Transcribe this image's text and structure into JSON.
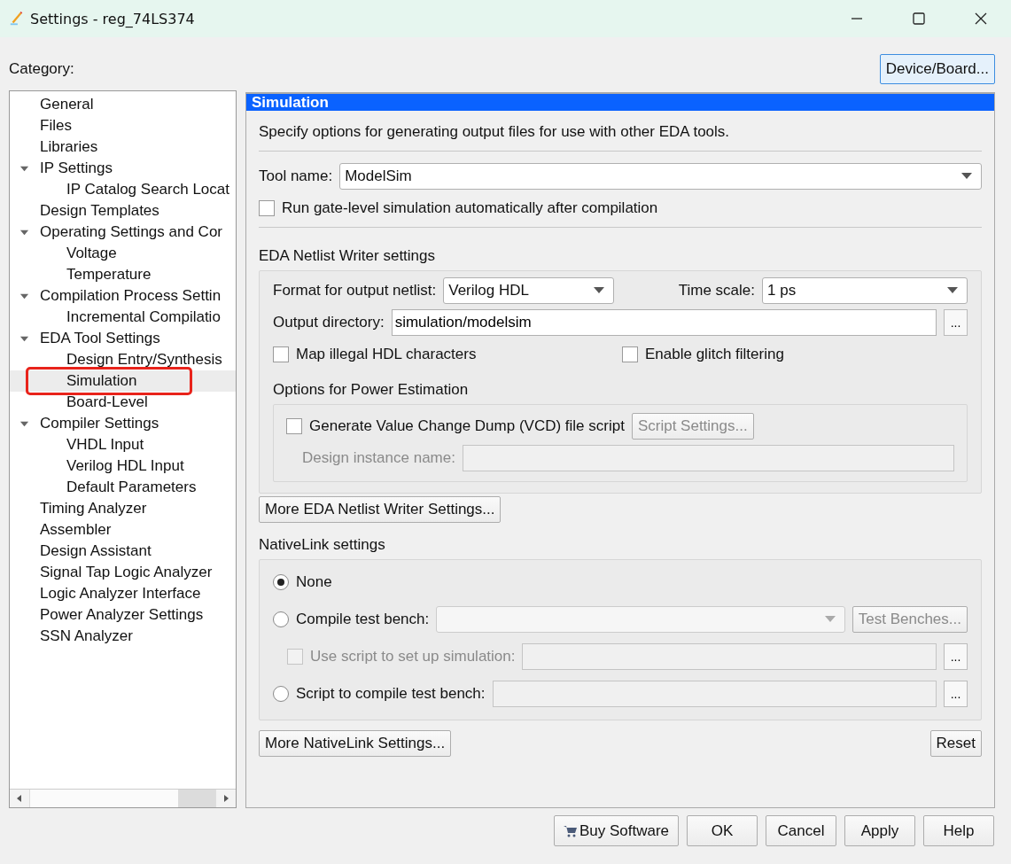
{
  "window": {
    "title": "Settings - reg_74LS374"
  },
  "category_label": "Category:",
  "device_board_button": "Device/Board...",
  "tree": [
    {
      "label": "General",
      "selected": false,
      "marked": false
    },
    {
      "label": "Files",
      "selected": false,
      "marked": false
    },
    {
      "label": "Libraries",
      "selected": false,
      "marked": false
    },
    {
      "label": "IP Settings",
      "selected": false,
      "marked": false,
      "expanded": true,
      "children": [
        {
          "label": "IP Catalog Search Locat",
          "selected": false,
          "marked": false
        }
      ]
    },
    {
      "label": "Design Templates",
      "selected": false,
      "marked": false
    },
    {
      "label": "Operating Settings and Cor",
      "selected": false,
      "marked": false,
      "expanded": true,
      "children": [
        {
          "label": "Voltage",
          "selected": false,
          "marked": false
        },
        {
          "label": "Temperature",
          "selected": false,
          "marked": false
        }
      ]
    },
    {
      "label": "Compilation Process Settin",
      "selected": false,
      "marked": false,
      "expanded": true,
      "children": [
        {
          "label": "Incremental Compilatio",
          "selected": false,
          "marked": false
        }
      ]
    },
    {
      "label": "EDA Tool Settings",
      "selected": false,
      "marked": false,
      "expanded": true,
      "children": [
        {
          "label": "Design Entry/Synthesis",
          "selected": false,
          "marked": false
        },
        {
          "label": "Simulation",
          "selected": true,
          "marked": true
        },
        {
          "label": "Board-Level",
          "selected": false,
          "marked": false
        }
      ]
    },
    {
      "label": "Compiler Settings",
      "selected": false,
      "marked": false,
      "expanded": true,
      "children": [
        {
          "label": "VHDL Input",
          "selected": false,
          "marked": false
        },
        {
          "label": "Verilog HDL Input",
          "selected": false,
          "marked": false
        },
        {
          "label": "Default Parameters",
          "selected": false,
          "marked": false
        }
      ]
    },
    {
      "label": "Timing Analyzer",
      "selected": false,
      "marked": false
    },
    {
      "label": "Assembler",
      "selected": false,
      "marked": false
    },
    {
      "label": "Design Assistant",
      "selected": false,
      "marked": false
    },
    {
      "label": "Signal Tap Logic Analyzer",
      "selected": false,
      "marked": false
    },
    {
      "label": "Logic Analyzer Interface",
      "selected": false,
      "marked": false
    },
    {
      "label": "Power Analyzer Settings",
      "selected": false,
      "marked": false
    },
    {
      "label": "SSN Analyzer",
      "selected": false,
      "marked": false
    }
  ],
  "panel": {
    "title": "Simulation",
    "description": "Specify options for generating output files for use with other EDA tools.",
    "tool_name": {
      "label": "Tool name:",
      "value": "ModelSim"
    },
    "run_gate_level": {
      "label": "Run gate-level simulation automatically after compilation",
      "checked": false
    },
    "netlist": {
      "heading": "EDA Netlist Writer settings",
      "format": {
        "label": "Format for output netlist:",
        "value": "Verilog HDL"
      },
      "time_scale": {
        "label": "Time scale:",
        "value": "1 ps"
      },
      "output_directory": {
        "label": "Output directory:",
        "value": "simulation/modelsim",
        "browse": "..."
      },
      "map_illegal": {
        "label": "Map illegal HDL characters",
        "checked": false
      },
      "glitch": {
        "label": "Enable glitch filtering",
        "checked": false
      },
      "power": {
        "heading": "Options for Power Estimation",
        "vcd": {
          "label": "Generate Value Change Dump (VCD) file script",
          "checked": false
        },
        "script_settings": {
          "label": "Script Settings...",
          "disabled": true
        },
        "instance": {
          "label": "Design instance name:",
          "disabled": true
        }
      }
    },
    "more_netlist_button": "More EDA Netlist Writer Settings...",
    "nativelink": {
      "heading": "NativeLink settings",
      "rows": [
        {
          "kind": "radio",
          "label": "None",
          "selected": true
        },
        {
          "kind": "radio-select",
          "label": "Compile test bench:",
          "selected": false,
          "button": {
            "label": "Test Benches...",
            "disabled": true
          }
        },
        {
          "kind": "checkbox",
          "label": "Use script to set up simulation:",
          "checked": false,
          "disabled": true,
          "browse": "..."
        },
        {
          "kind": "radio-file",
          "label": "Script to compile test bench:",
          "selected": false,
          "browse": "..."
        }
      ]
    },
    "more_nativelink_button": "More NativeLink Settings...",
    "reset_button": "Reset"
  },
  "buttons": [
    {
      "label": "Buy Software",
      "kind": "cart"
    },
    {
      "label": "OK",
      "kind": "plain"
    },
    {
      "label": "Cancel",
      "kind": "plain"
    },
    {
      "label": "Apply",
      "kind": "plain"
    },
    {
      "label": "Help",
      "kind": "plain"
    }
  ]
}
